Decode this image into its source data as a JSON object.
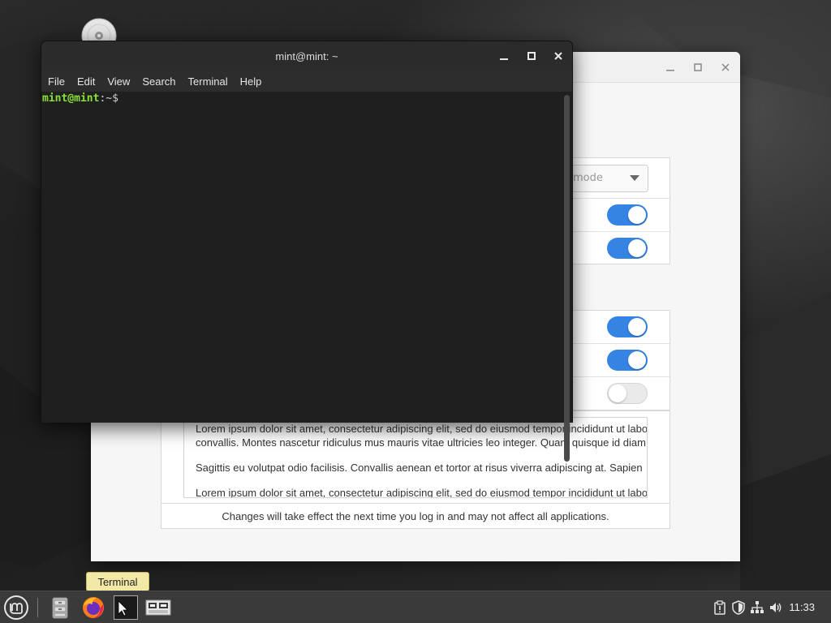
{
  "terminal": {
    "title": "mint@mint: ~",
    "menu": [
      "File",
      "Edit",
      "View",
      "Search",
      "Terminal",
      "Help"
    ],
    "prompt_user": "mint@mint",
    "prompt_path": ":~$"
  },
  "settings": {
    "combo_value": "mode",
    "toggles": [
      {
        "state": "on"
      },
      {
        "state": "on"
      },
      {
        "state": "on"
      },
      {
        "state": "on"
      },
      {
        "state": "off"
      }
    ],
    "lorem": [
      "Lorem ipsum dolor sit amet, consectetur adipiscing elit, sed do eiusmod tempor incididunt ut labore",
      "convallis. Montes nascetur ridiculus mus mauris vitae ultricies leo integer. Quam quisque id diam",
      "Sagittis eu volutpat odio facilisis. Convallis aenean et tortor at risus viverra adipiscing at. Sapien",
      "Lorem ipsum dolor sit amet, consectetur adipiscing elit, sed do eiusmod tempor incididunt ut labore"
    ],
    "note": "Changes will take effect the next time you log in and may not affect all applications."
  },
  "tooltip": "Terminal",
  "taskbar": {
    "clock": "11:33",
    "items": [
      "menu-icon",
      "files-icon",
      "firefox-icon",
      "terminal-icon",
      "workspace-switcher-icon"
    ],
    "tray": [
      "clipboard-icon",
      "shield-icon",
      "network-icon",
      "volume-icon"
    ]
  },
  "colors": {
    "accent": "#3584e4",
    "prompt_green": "#8ae234",
    "terminal_bg": "#1f1f1f"
  }
}
